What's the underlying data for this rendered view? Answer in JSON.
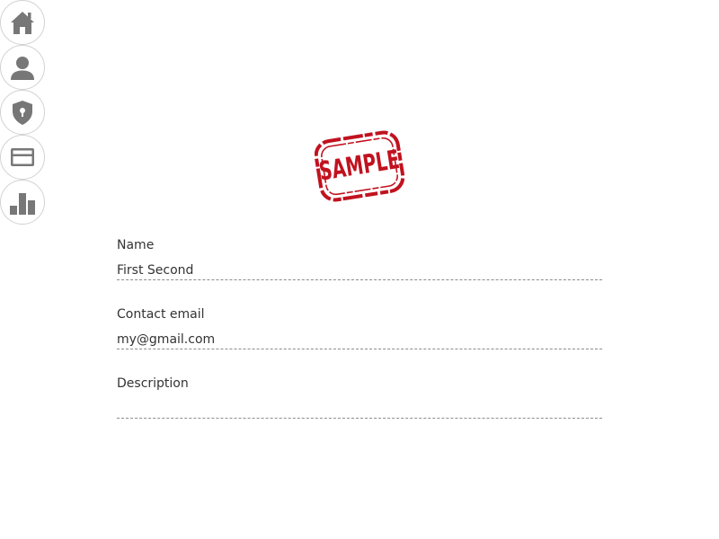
{
  "nav": {
    "items": [
      {
        "icon": "home-icon"
      },
      {
        "icon": "user-icon"
      },
      {
        "icon": "shield-icon"
      },
      {
        "icon": "credit-card-icon"
      },
      {
        "icon": "bar-chart-icon"
      }
    ],
    "icon_color": "#777777"
  },
  "stamp": {
    "text": "SAMPLE",
    "color": "#c1121f"
  },
  "form": {
    "name": {
      "label": "Name",
      "value": "First Second",
      "placeholder": ""
    },
    "email": {
      "label": "Contact email",
      "value": "my@gmail.com",
      "placeholder": ""
    },
    "description": {
      "label": "Description",
      "value": "",
      "placeholder": ""
    }
  }
}
